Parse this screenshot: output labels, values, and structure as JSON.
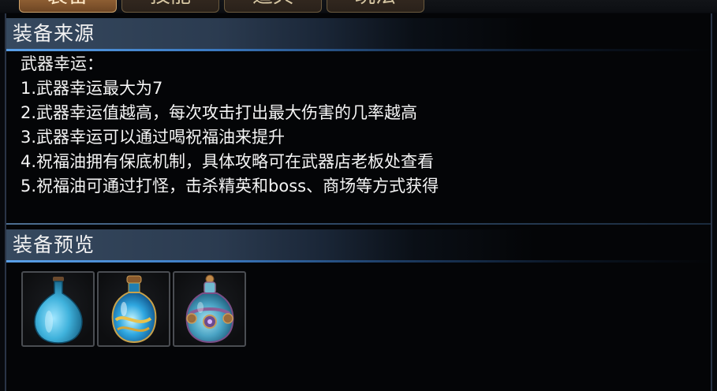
{
  "tabs": [
    {
      "label": "装备",
      "active": true
    },
    {
      "label": "技能",
      "active": false
    },
    {
      "label": "道具",
      "active": false
    },
    {
      "label": "玩法",
      "active": false
    }
  ],
  "source_section": {
    "title": "装备来源",
    "lines": [
      "武器幸运：",
      "1.武器幸运最大为7",
      "2.武器幸运值越高，每次攻击打出最大伤害的几率越高",
      "3.武器幸运可以通过喝祝福油来提升",
      "4.祝福油拥有保底机制，具体攻略可在武器店老板处查看",
      "5.祝福油可通过打怪，击杀精英和boss、商场等方式获得"
    ]
  },
  "preview_section": {
    "title": "装备预览",
    "items": [
      {
        "icon": "blue-potion-bottle-icon"
      },
      {
        "icon": "blessing-oil-bottle-icon"
      },
      {
        "icon": "jeweled-potion-bottle-icon"
      }
    ]
  },
  "colors": {
    "header_accent": "#5aa0e8",
    "panel_bg": "#040507",
    "text": "#f4f4f4"
  }
}
